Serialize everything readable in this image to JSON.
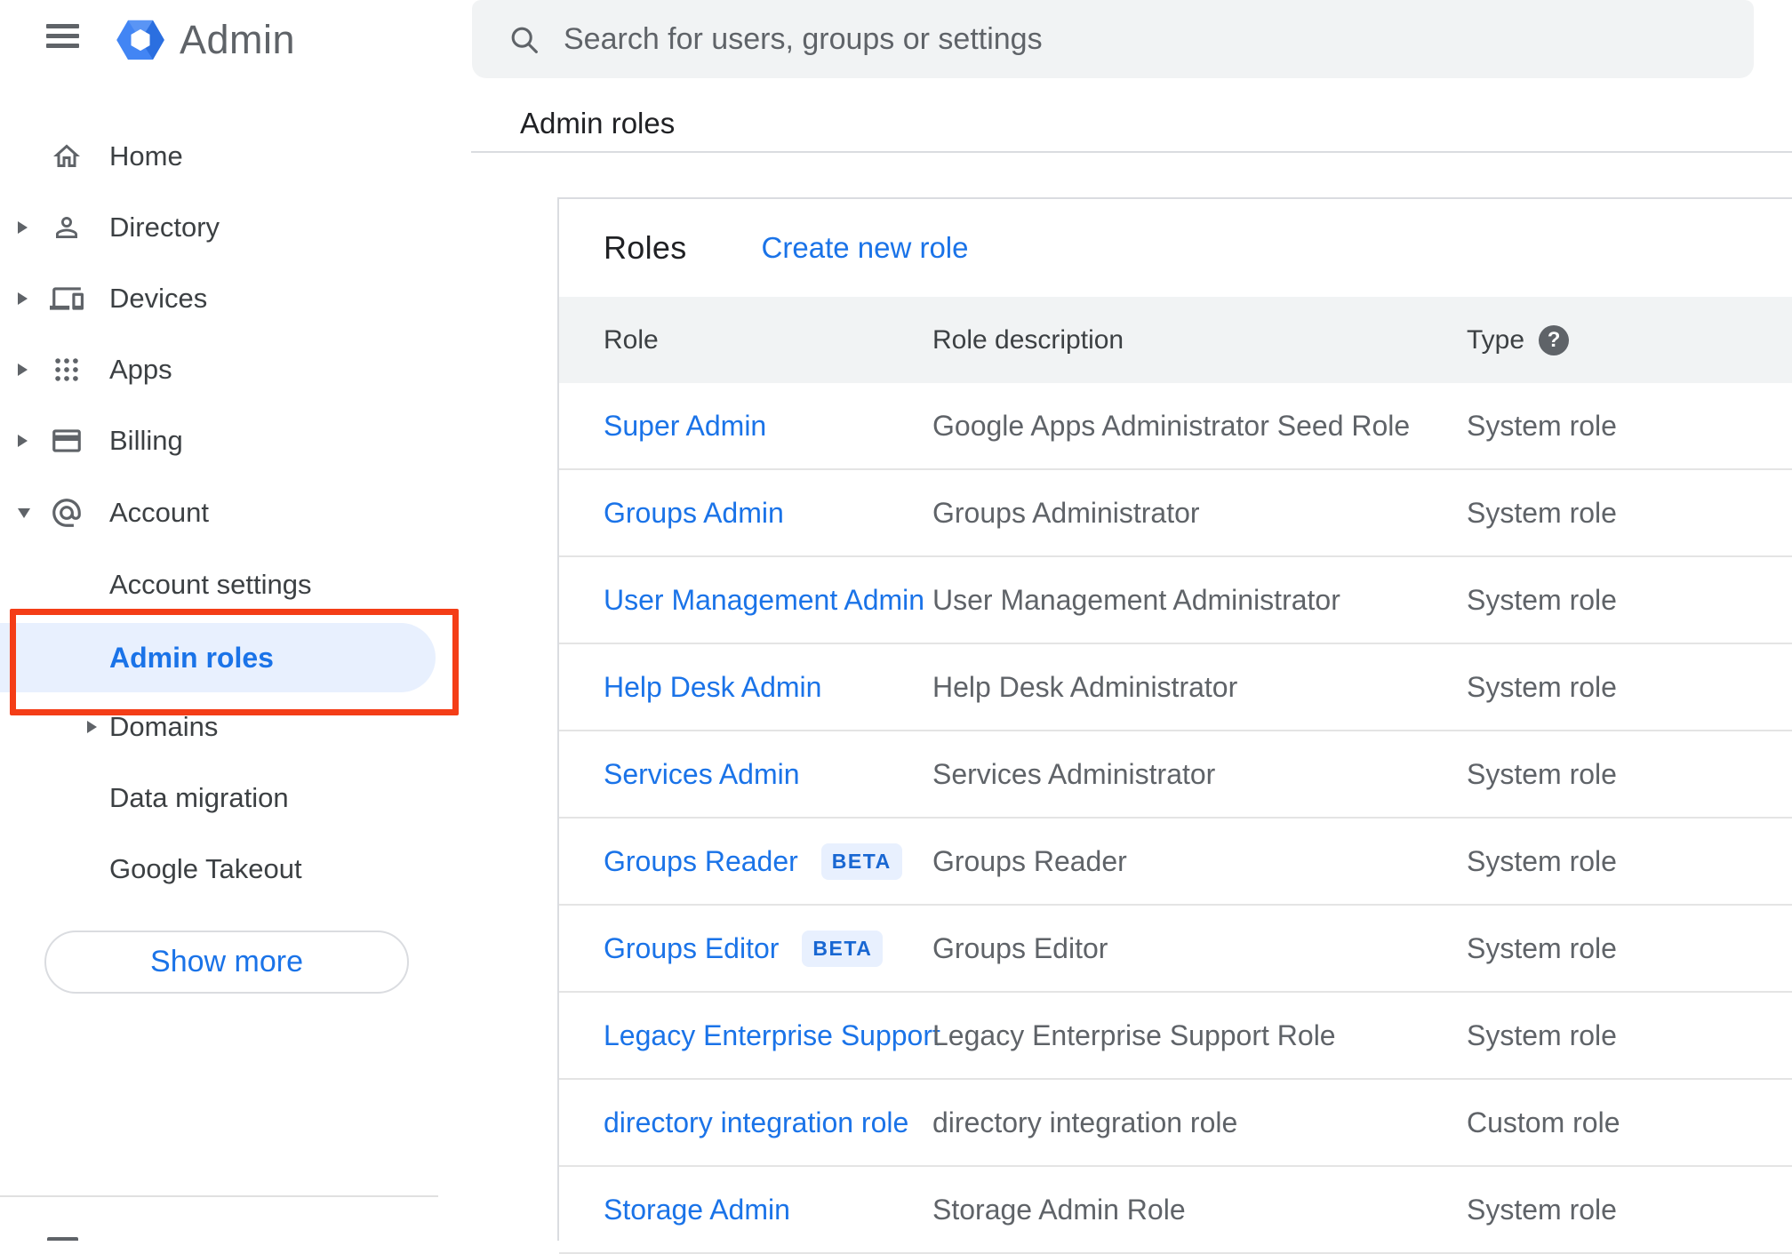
{
  "sidebar": {
    "app_title": "Admin",
    "items": [
      {
        "label": "Home",
        "expandable": false
      },
      {
        "label": "Directory",
        "expandable": true
      },
      {
        "label": "Devices",
        "expandable": true
      },
      {
        "label": "Apps",
        "expandable": true
      },
      {
        "label": "Billing",
        "expandable": true
      },
      {
        "label": "Account",
        "expandable": true,
        "expanded": true
      }
    ],
    "account_sub_items": [
      {
        "label": "Account settings",
        "active": false
      },
      {
        "label": "Admin roles",
        "active": true
      },
      {
        "label": "Domains",
        "expandable": true
      },
      {
        "label": "Data migration"
      },
      {
        "label": "Google Takeout"
      }
    ],
    "show_more_label": "Show more"
  },
  "topbar": {
    "search_placeholder": "Search for users, groups or settings"
  },
  "breadcrumb": "Admin roles",
  "roles_card": {
    "title": "Roles",
    "create_link": "Create new role",
    "columns": {
      "role": "Role",
      "description": "Role description",
      "type": "Type"
    },
    "rows": [
      {
        "name": "Super Admin",
        "badge": "",
        "description": "Google Apps Administrator Seed Role",
        "type": "System role"
      },
      {
        "name": "Groups Admin",
        "badge": "",
        "description": "Groups Administrator",
        "type": "System role"
      },
      {
        "name": "User Management Admin",
        "badge": "",
        "description": "User Management Administrator",
        "type": "System role"
      },
      {
        "name": "Help Desk Admin",
        "badge": "",
        "description": "Help Desk Administrator",
        "type": "System role"
      },
      {
        "name": "Services Admin",
        "badge": "",
        "description": "Services Administrator",
        "type": "System role"
      },
      {
        "name": "Groups Reader",
        "badge": "BETA",
        "description": "Groups Reader",
        "type": "System role"
      },
      {
        "name": "Groups Editor",
        "badge": "BETA",
        "description": "Groups Editor",
        "type": "System role"
      },
      {
        "name": "Legacy Enterprise Support",
        "badge": "",
        "description": "Legacy Enterprise Support Role",
        "type": "System role"
      },
      {
        "name": "directory integration role",
        "badge": "",
        "description": "directory integration role",
        "type": "Custom role"
      },
      {
        "name": "Storage Admin",
        "badge": "",
        "description": "Storage Admin Role",
        "type": "System role"
      }
    ]
  },
  "colors": {
    "accent_blue": "#1a73e8",
    "pill_background": "#e8f0fe",
    "annotation_red": "#f43d17",
    "header_gray": "#f1f3f4",
    "text_gray": "#5f6368"
  }
}
